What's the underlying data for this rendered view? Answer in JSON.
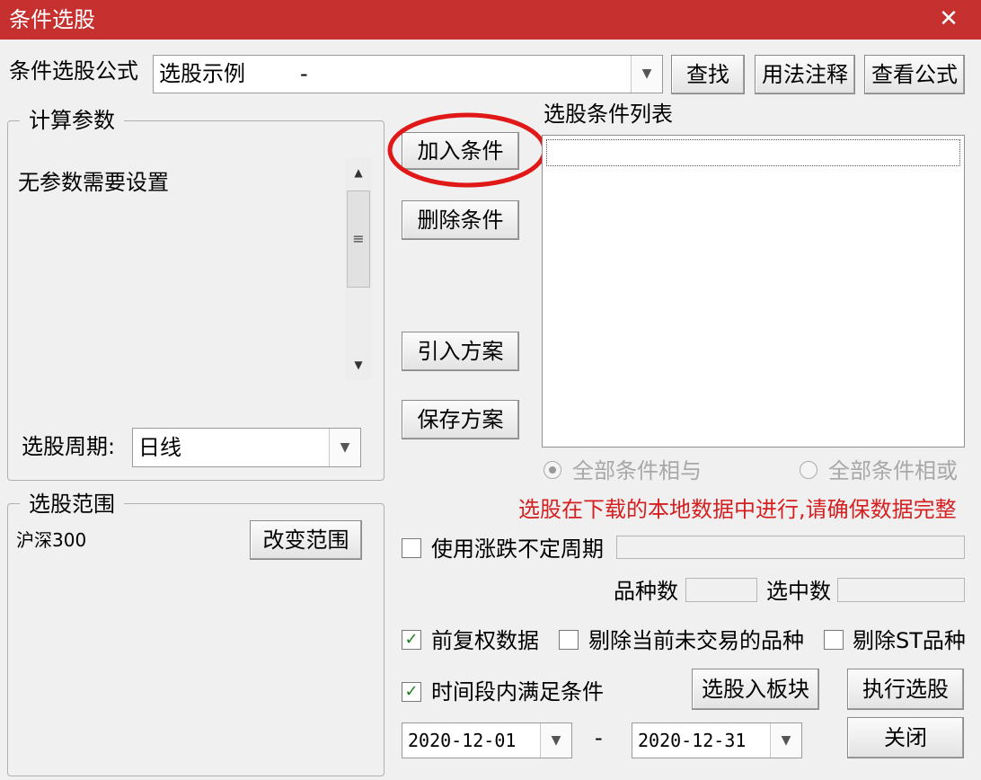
{
  "window": {
    "title": "条件选股",
    "close_glyph": "✕"
  },
  "formula": {
    "label": "条件选股公式",
    "value": "选股示例        -",
    "find_button": "查找",
    "usage_button": "用法注释",
    "view_button": "查看公式"
  },
  "params": {
    "group_label": "计算参数",
    "message": "无参数需要设置",
    "period_label": "选股周期:",
    "period_value": "日线"
  },
  "scope": {
    "group_label": "选股范围",
    "value": "沪深300",
    "change_button": "改变范围"
  },
  "actions": {
    "add": "加入条件",
    "delete": "删除条件",
    "import": "引入方案",
    "save": "保存方案"
  },
  "conditions": {
    "label": "选股条件列表",
    "radio_and": "全部条件相与",
    "radio_or": "全部条件相或",
    "and_selected": true
  },
  "warning": {
    "text": "选股在下载的本地数据中进行,请确保数据完整",
    "color": "#d42020"
  },
  "options": {
    "variable_period_label": "使用涨跌不定周期",
    "variable_period_checked": false,
    "count_label": "品种数",
    "selected_label": "选中数",
    "forward_adjust_label": "前复权数据",
    "forward_adjust_checked": true,
    "exclude_untraded_label": "剔除当前未交易的品种",
    "exclude_untraded_checked": false,
    "exclude_st_label": "剔除ST品种",
    "exclude_st_checked": false,
    "time_range_label": "时间段内满足条件",
    "time_range_checked": true
  },
  "dates": {
    "start": "2020-12-01",
    "separator": "-",
    "end": "2020-12-31"
  },
  "bottom_buttons": {
    "to_block": "选股入板块",
    "execute": "执行选股",
    "close": "关闭"
  },
  "colors": {
    "titlebar": "#c6302f",
    "highlight_circle": "#e01818",
    "check": "#1a7f1a"
  },
  "icons": {
    "dropdown": "▼",
    "scroll_up": "▲",
    "scroll_down": "▼",
    "grip": "≡"
  }
}
